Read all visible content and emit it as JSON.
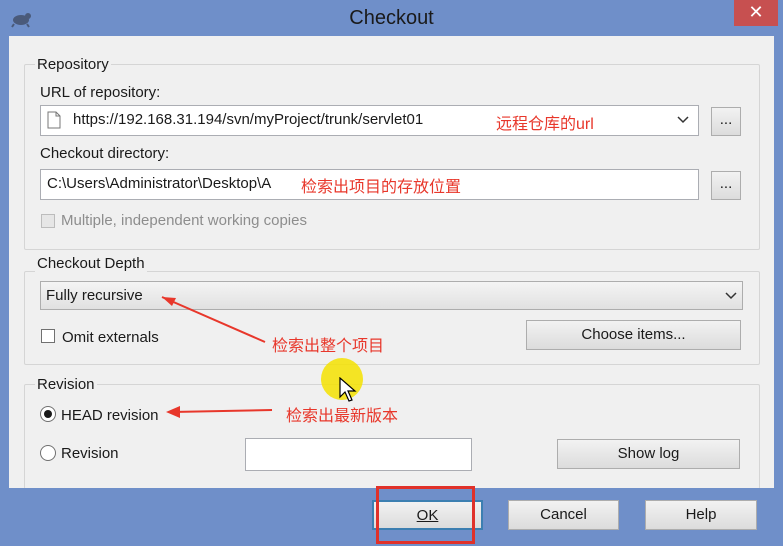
{
  "window": {
    "title": "Checkout",
    "close_label": "✕"
  },
  "repository": {
    "group_label": "Repository",
    "url_label": "URL of repository:",
    "url_value": "https://192.168.31.194/svn/myProject/trunk/servlet01",
    "url_annotation": "远程仓库的url",
    "browse_label": "...",
    "dir_label": "Checkout directory:",
    "dir_value": "C:\\Users\\Administrator\\Desktop\\A",
    "dir_annotation": "检索出项目的存放位置",
    "multiple_label": "Multiple, independent working copies"
  },
  "depth": {
    "group_label": "Checkout Depth",
    "selected": "Fully recursive",
    "omit_label": "Omit externals",
    "choose_label": "Choose items...",
    "annotation": "检索出整个项目"
  },
  "revision": {
    "group_label": "Revision",
    "head_label": "HEAD revision",
    "rev_label": "Revision",
    "rev_value": "",
    "showlog_label": "Show log",
    "annotation": "检索出最新版本"
  },
  "buttons": {
    "ok": "OK",
    "cancel": "Cancel",
    "help": "Help"
  },
  "colors": {
    "annotation": "#e8372b",
    "titlebar": "#6f8fc9",
    "close": "#c75050",
    "highlight": "#f5e200"
  }
}
